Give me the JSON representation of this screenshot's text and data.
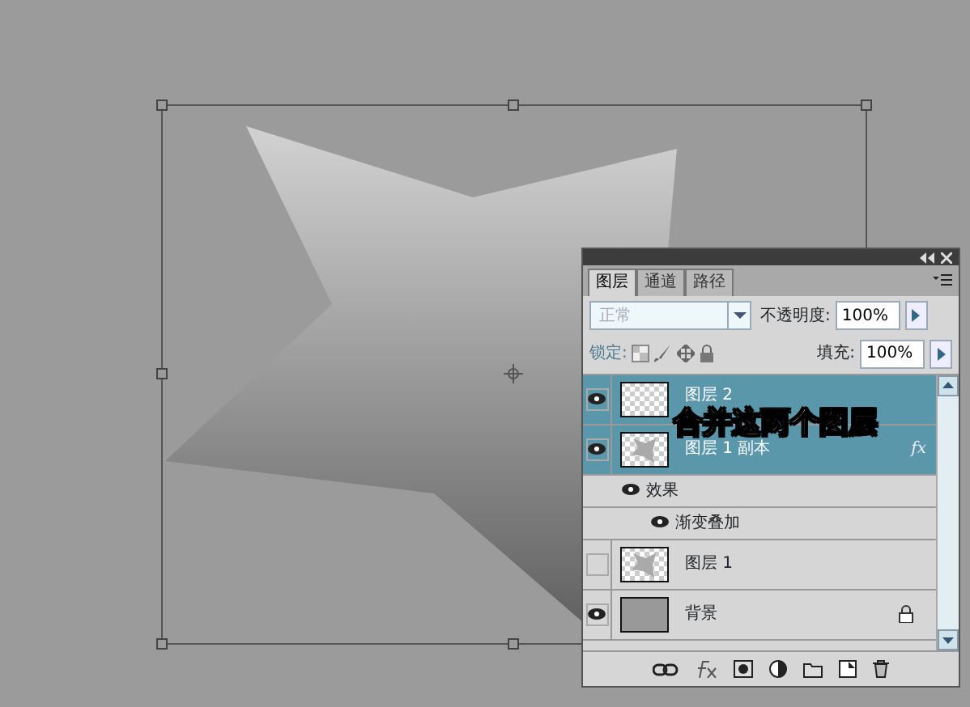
{
  "canvas": {
    "selection_handles": true
  },
  "panel": {
    "tabs": [
      {
        "label": "图层",
        "selected": true
      },
      {
        "label": "通道",
        "selected": false
      },
      {
        "label": "路径",
        "selected": false
      }
    ],
    "blend_mode": {
      "value": "正常",
      "disabled": true
    },
    "opacity": {
      "label": "不透明度:",
      "value": "100%"
    },
    "lock": {
      "label": "锁定:"
    },
    "fill": {
      "label": "填充:",
      "value": "100%"
    },
    "layers": [
      {
        "name": "图层 2",
        "visible": true,
        "selected": true,
        "kind": "transparent",
        "locked": false
      },
      {
        "name": "图层 1 副本",
        "visible": true,
        "selected": true,
        "kind": "shape",
        "locked": false,
        "badge": "fx",
        "children": [
          {
            "name": "效果",
            "visible": true,
            "children": [
              {
                "name": "渐变叠加",
                "visible": true
              }
            ]
          }
        ]
      },
      {
        "name": "图层 1",
        "visible": false,
        "selected": false,
        "kind": "shape",
        "locked": false
      },
      {
        "name": "背景",
        "visible": true,
        "selected": false,
        "kind": "fill",
        "locked": true
      }
    ]
  },
  "annotation": "合并这两个图层"
}
